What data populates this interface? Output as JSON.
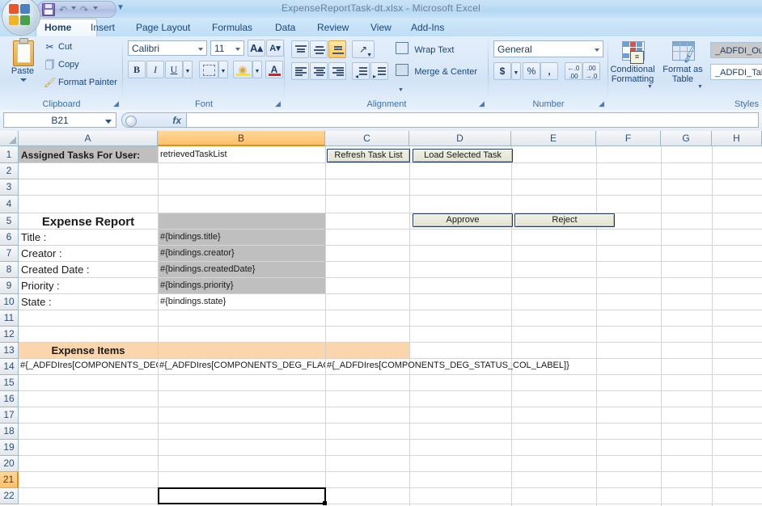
{
  "window": {
    "title": "ExpenseReportTask-dt.xlsx - Microsoft Excel",
    "office_button": "office-orb"
  },
  "quick_access": {
    "save": "Save",
    "undo": "Undo",
    "redo": "Redo",
    "customize": "Customize Quick Access Toolbar"
  },
  "ribbon": {
    "tabs": [
      {
        "label": "Home",
        "active": true
      },
      {
        "label": "Insert",
        "active": false
      },
      {
        "label": "Page Layout",
        "active": false
      },
      {
        "label": "Formulas",
        "active": false
      },
      {
        "label": "Data",
        "active": false
      },
      {
        "label": "Review",
        "active": false
      },
      {
        "label": "View",
        "active": false
      },
      {
        "label": "Add-Ins",
        "active": false
      }
    ],
    "groups": {
      "clipboard": {
        "label": "Clipboard",
        "paste": "Paste",
        "cut": "Cut",
        "copy": "Copy",
        "format_painter": "Format Painter"
      },
      "font": {
        "label": "Font",
        "font_name": "Calibri",
        "font_size": "11",
        "grow_font": "A",
        "shrink_font": "A",
        "bold": "B",
        "italic": "I",
        "underline": "U",
        "borders": "Borders",
        "fill_color": "Fill Color",
        "font_color": "Font Color"
      },
      "alignment": {
        "label": "Alignment",
        "top_align": "Top Align",
        "middle_align": "Middle Align",
        "bottom_align": "Bottom Align",
        "orientation": "Orientation",
        "align_left": "Align Text Left",
        "center": "Center",
        "align_right": "Align Text Right",
        "decrease_indent": "Decrease Indent",
        "increase_indent": "Increase Indent",
        "wrap_text": "Wrap Text",
        "merge_center": "Merge & Center"
      },
      "number": {
        "label": "Number",
        "format": "General",
        "accounting": "$",
        "percent": "%",
        "comma": ",",
        "increase_decimal": ".00",
        "decrease_decimal": ".00"
      },
      "styles": {
        "label": "Styles",
        "conditional_formatting": "Conditional Formatting",
        "format_as_table": "Format as Table",
        "cell_style_1": "_ADFDI_Out",
        "cell_style_2": "_ADFDI_Tab"
      }
    }
  },
  "formula_bar": {
    "name_box": "B21",
    "fx_label": "fx",
    "formula_value": ""
  },
  "sheet": {
    "columns": [
      "A",
      "B",
      "C",
      "D",
      "E",
      "F",
      "G",
      "H"
    ],
    "highlighted_column": "B",
    "rows": [
      "1",
      "2",
      "3",
      "4",
      "5",
      "6",
      "7",
      "8",
      "9",
      "10",
      "11",
      "12",
      "13",
      "14",
      "15",
      "16",
      "17",
      "18",
      "19",
      "20",
      "21",
      "22"
    ],
    "highlighted_row": "21",
    "selected_cell": "B21",
    "cells": {
      "a1": "Assigned Tasks For User:",
      "b1": "retrievedTaskList",
      "a4": "Expense Report",
      "a5": "Title :",
      "b5": "#{bindings.title}",
      "a6": "Creator :",
      "b6": "#{bindings.creator}",
      "a7": "Created Date :",
      "b7": "#{bindings.createdDate}",
      "a8": "Priority :",
      "b8": "#{bindings.priority}",
      "a9": "State :",
      "b9": "#{bindings.state}",
      "a12": "Expense Items",
      "a13": "#{_ADFDIres[COMPONENTS_DEG_(",
      "b13": "#{_ADFDIres[COMPONENTS_DEG_FLAGG",
      "c13": "#{_ADFDIres[COMPONENTS_DEG_STATUS_COL_LABEL]}"
    },
    "buttons": {
      "refresh_task_list": "Refresh Task List",
      "load_selected_task": "Load Selected Task",
      "approve": "Approve",
      "reject": "Reject"
    }
  },
  "colors": {
    "header_gray_fill": "#BFBFBF",
    "adfdi_orange_fill": "#FBD5AC",
    "selection_orange": "#FFC06B",
    "tab_blue": "#16477D"
  }
}
